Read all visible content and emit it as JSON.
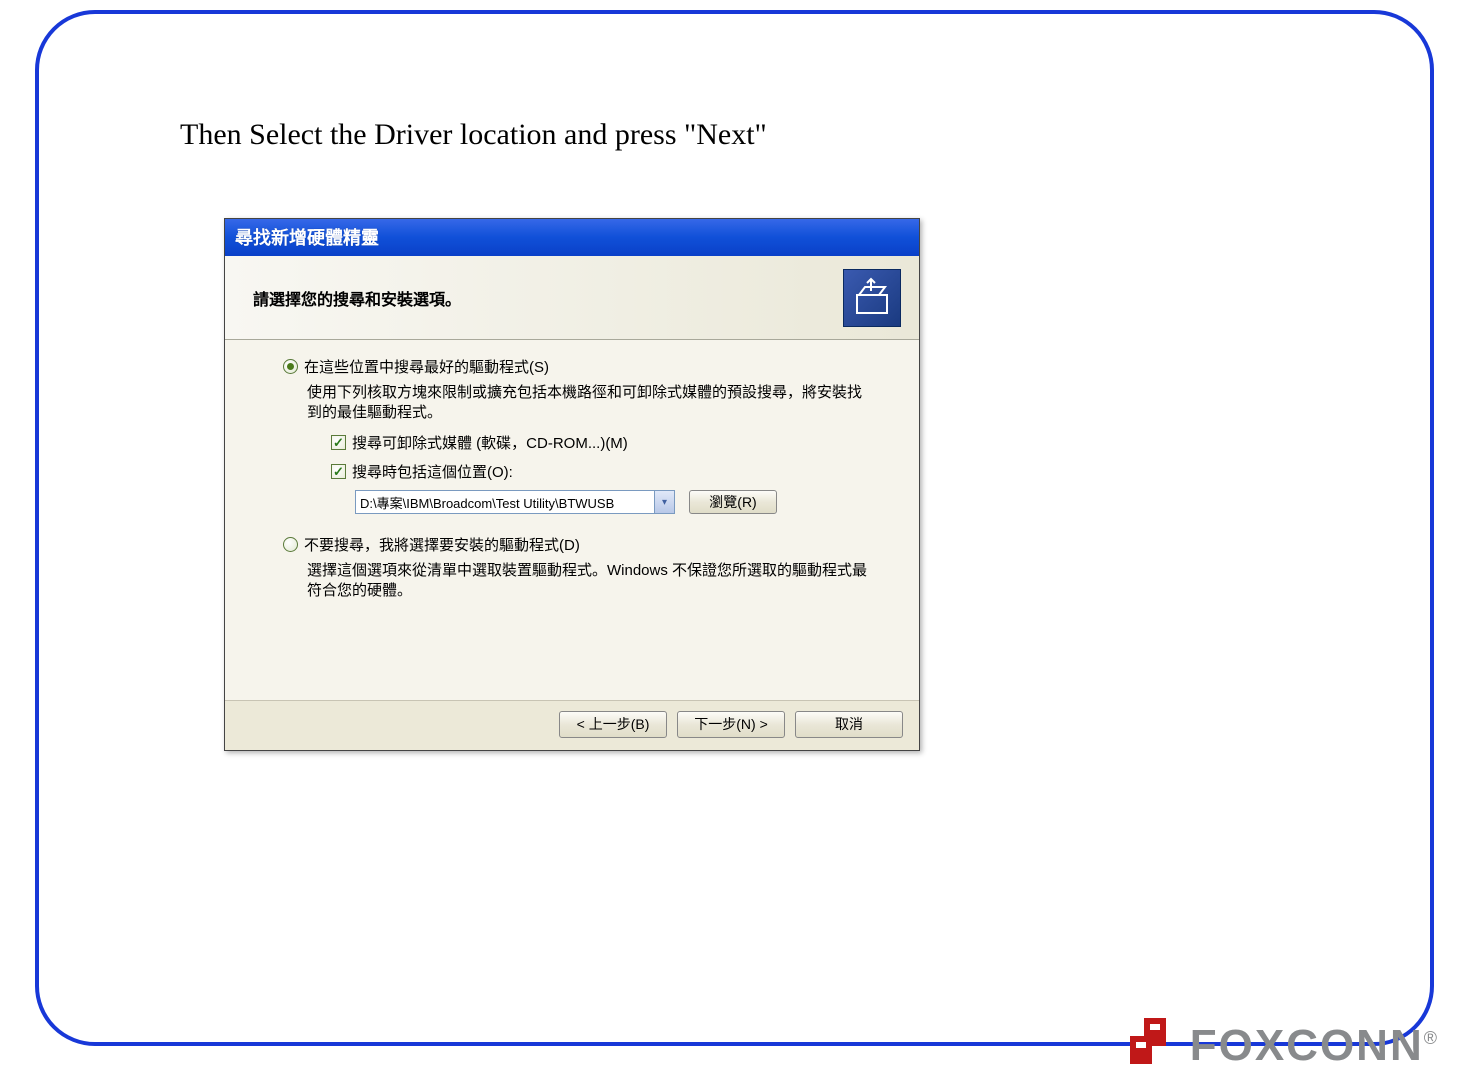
{
  "instruction": "Then Select the Driver location and press \"Next\"",
  "dialog": {
    "title": "尋找新增硬體精靈",
    "heading": "請選擇您的搜尋和安裝選項。",
    "option1": {
      "label": "在這些位置中搜尋最好的驅動程式(S)",
      "desc": "使用下列核取方塊來限制或擴充包括本機路徑和可卸除式媒體的預設搜尋，將安裝找到的最佳驅動程式。",
      "check1": "搜尋可卸除式媒體 (軟碟，CD-ROM...)(M)",
      "check2": "搜尋時包括這個位置(O):",
      "path": "D:\\專案\\IBM\\Broadcom\\Test Utility\\BTWUSB",
      "browse": "瀏覽(R)"
    },
    "option2": {
      "label": "不要搜尋，我將選擇要安裝的驅動程式(D)",
      "desc": "選擇這個選項來從清單中選取裝置驅動程式。Windows 不保證您所選取的驅動程式最符合您的硬體。"
    },
    "buttons": {
      "back": "< 上一步(B)",
      "next": "下一步(N) >",
      "cancel": "取消"
    }
  },
  "brand": {
    "name": "FOXCONN",
    "mark": "®"
  }
}
